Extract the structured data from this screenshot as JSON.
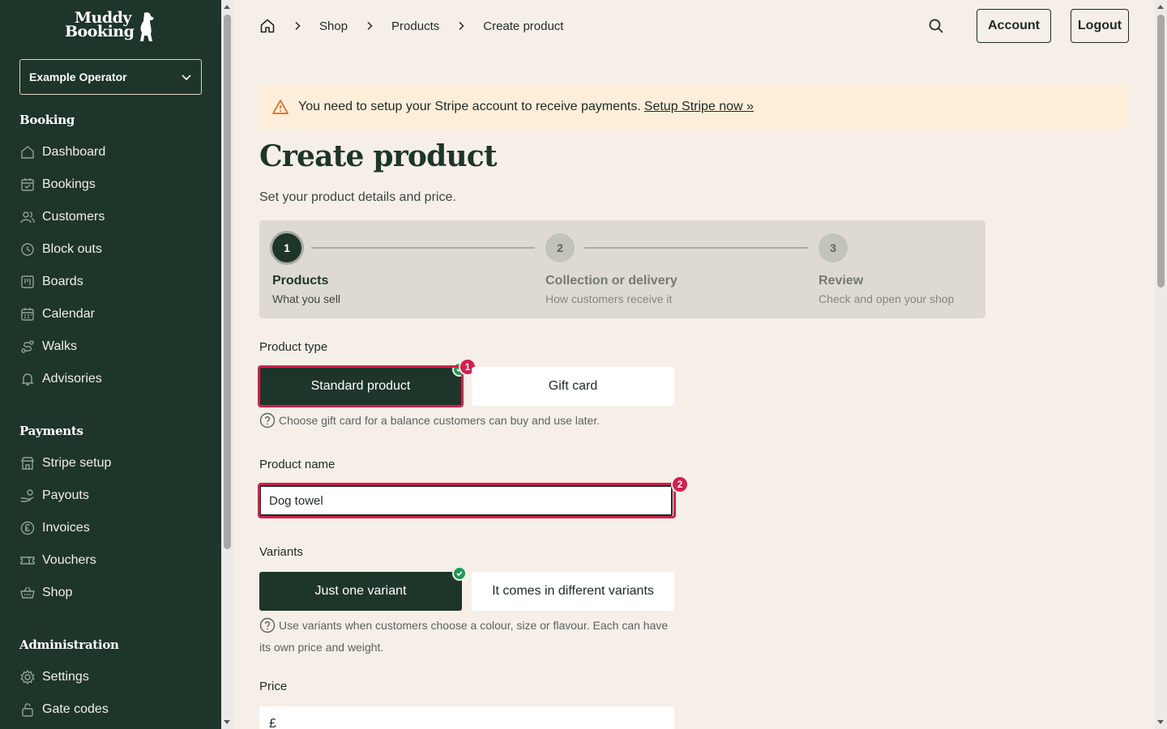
{
  "sidebar": {
    "logo": {
      "line1": "Muddy",
      "line2": "Booking"
    },
    "operator": {
      "label": "Example Operator"
    },
    "sections": [
      {
        "title": "Booking",
        "items": [
          {
            "label": "Dashboard",
            "icon": "home-icon"
          },
          {
            "label": "Bookings",
            "icon": "calendar-check-icon"
          },
          {
            "label": "Customers",
            "icon": "users-icon"
          },
          {
            "label": "Block outs",
            "icon": "clock-icon"
          },
          {
            "label": "Boards",
            "icon": "board-icon"
          },
          {
            "label": "Calendar",
            "icon": "calendar-icon"
          },
          {
            "label": "Walks",
            "icon": "route-icon"
          },
          {
            "label": "Advisories",
            "icon": "bell-icon"
          }
        ]
      },
      {
        "title": "Payments",
        "items": [
          {
            "label": "Stripe setup",
            "icon": "store-icon"
          },
          {
            "label": "Payouts",
            "icon": "hand-coins-icon"
          },
          {
            "label": "Invoices",
            "icon": "pound-icon"
          },
          {
            "label": "Vouchers",
            "icon": "ticket-icon"
          },
          {
            "label": "Shop",
            "icon": "basket-icon"
          }
        ]
      },
      {
        "title": "Administration",
        "items": [
          {
            "label": "Settings",
            "icon": "gear-icon"
          },
          {
            "label": "Gate codes",
            "icon": "lock-icon"
          }
        ]
      }
    ]
  },
  "header": {
    "breadcrumb": [
      "Shop",
      "Products",
      "Create product"
    ],
    "account_label": "Account",
    "logout_label": "Logout"
  },
  "alert": {
    "text": "You need to setup your Stripe account to receive payments.",
    "link": "Setup Stripe now »"
  },
  "main": {
    "title": "Create product",
    "subtitle": "Set your product details and price."
  },
  "stepper": {
    "steps": [
      {
        "number": "1",
        "title": "Products",
        "desc": "What you sell",
        "active": true
      },
      {
        "number": "2",
        "title": "Collection or delivery",
        "desc": "How customers receive it",
        "active": false
      },
      {
        "number": "3",
        "title": "Review",
        "desc": "Check and open your shop",
        "active": false
      }
    ]
  },
  "form": {
    "product_type": {
      "label": "Product type",
      "options": [
        "Standard product",
        "Gift card"
      ],
      "selected": "Standard product",
      "hint": "Choose gift card for a balance customers can buy and use later."
    },
    "product_name": {
      "label": "Product name",
      "value": "Dog towel"
    },
    "variants": {
      "label": "Variants",
      "options": [
        "Just one variant",
        "It comes in different variants"
      ],
      "selected": "Just one variant",
      "hint": "Use variants when customers choose a colour, size or flavour. Each can have its own price and weight."
    },
    "price": {
      "label": "Price",
      "prefix": "£"
    }
  },
  "annotations": {
    "badge1": "1",
    "badge2": "2"
  },
  "colors": {
    "sidebar_bg": "#1e3529",
    "page_bg": "#f6efe8",
    "alert_bg": "#fdeeda",
    "highlight": "#d41f4b",
    "success": "#1d9a52"
  }
}
